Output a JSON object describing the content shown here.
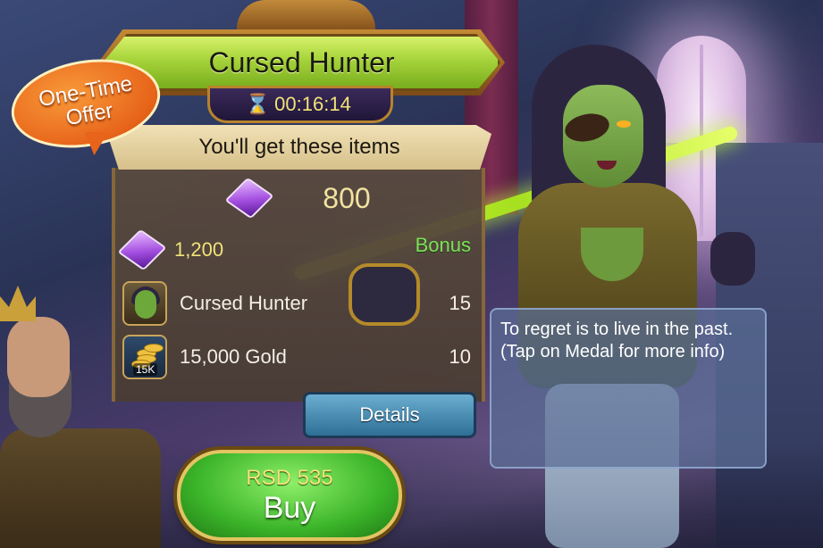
{
  "offer": {
    "title": "Cursed Hunter",
    "timer": "00:16:14",
    "badge_line1": "One-Time",
    "badge_line2": "Offer",
    "items_header": "You'll get these items"
  },
  "main_reward": {
    "icon": "purple-gem-icon",
    "amount": "800"
  },
  "items": [
    {
      "icon": "purple-gem-icon",
      "label": "1,200",
      "qty": "",
      "tag": "Bonus"
    },
    {
      "icon": "cursed-hunter-medal-icon",
      "label": "Cursed Hunter",
      "qty": "15"
    },
    {
      "icon": "gold-pile-icon",
      "label": "15,000 Gold",
      "qty": "10",
      "badge": "15K"
    }
  ],
  "buttons": {
    "details": "Details",
    "buy_price": "RSD 535",
    "buy": "Buy"
  },
  "tooltip": {
    "line1": "To regret is to live in the past.",
    "line2": "(Tap on Medal for more info)"
  },
  "colors": {
    "title_green": "#a6d33a",
    "offer_orange": "#e7641a",
    "bonus_green": "#7ee05a",
    "gold_text": "#f1e27a",
    "buy_green": "#3cb52a",
    "details_blue": "#2f6f96"
  }
}
